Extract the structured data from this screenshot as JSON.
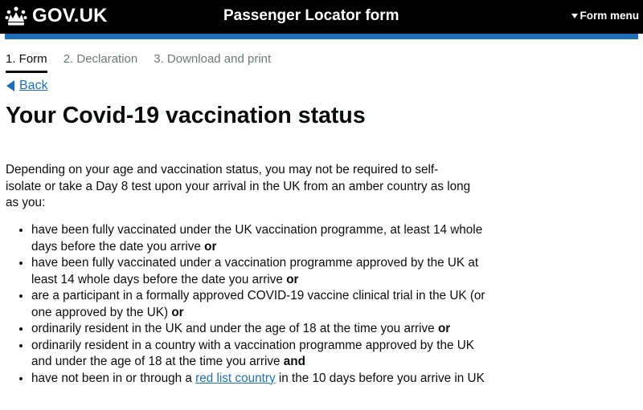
{
  "header": {
    "logo_text": "GOV.UK",
    "service_name": "Passenger Locator form",
    "menu_label": "Form menu",
    "icons": {
      "logo": "crown-icon",
      "menu": "caret-down-icon"
    }
  },
  "colors": {
    "header_bg": "#000000",
    "accent_bar": "#1d70b8",
    "link": "#1d70b8",
    "text": "#0b0c0c",
    "muted": "#6f777b"
  },
  "steps": [
    {
      "label": "1. Form",
      "current": true
    },
    {
      "label": "2. Declaration",
      "current": false
    },
    {
      "label": "3. Download and print",
      "current": false
    }
  ],
  "back_link": {
    "label": "Back",
    "icon": "back-arrow-icon"
  },
  "page_title": "Your Covid-19 vaccination status",
  "intro": "Depending on your age and vaccination status, you may not be required to self-isolate or take a Day 8 test upon your arrival in the UK from an amber country as long as you:",
  "conditions": [
    {
      "text": "have been fully vaccinated under the UK vaccination programme, at least 14 whole days before the date you arrive",
      "connector": "or"
    },
    {
      "text": "have been fully vaccinated under a vaccination programme approved by the UK at least 14 whole days before the date you arrive",
      "connector": "or"
    },
    {
      "text": "are a participant in a formally approved COVID-19 vaccine clinical trial in the UK (or one approved by the UK)",
      "connector": "or"
    },
    {
      "text": "ordinarily resident in the UK and under the age of 18 at the time you arrive",
      "connector": "or"
    },
    {
      "text": "ordinarily resident in a country with a vaccination programme approved by the UK and under the age of 18 at the time you arrive",
      "connector": "and"
    },
    {
      "text_before": "have not been in or through a",
      "link": "red list country",
      "text_after": "in the 10 days before you arrive in UK"
    }
  ]
}
